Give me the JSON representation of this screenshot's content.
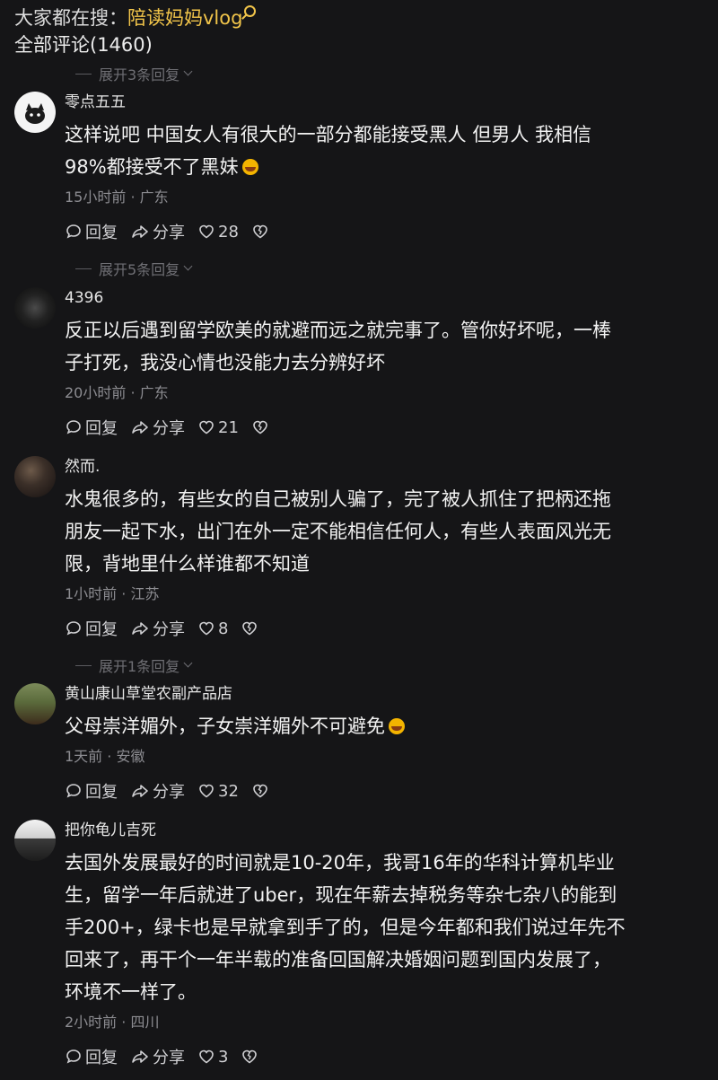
{
  "header": {
    "search_prefix": "大家都在搜：",
    "search_keyword": "陪读妈妈vlog",
    "total_comments": "全部评论(1460)"
  },
  "expand_labels": [
    "展开3条回复",
    "展开5条回复",
    "展开1条回复"
  ],
  "actions": {
    "reply": "回复",
    "share": "分享"
  },
  "comments": [
    {
      "name": "零点五五",
      "text_1": "这样说吧  中国女人有很大的一部分都能接受黑人     但男人  我相信",
      "text_2": "98%都接受不了黑妹",
      "meta": "15小时前 · 广东",
      "likes": "28"
    },
    {
      "name": "4396",
      "text_1": "反正以后遇到留学欧美的就避而远之就完事了。管你好坏呢，一棒",
      "text_2": "子打死，我没心情也没能力去分辨好坏",
      "meta": "20小时前 · 广东",
      "likes": "21"
    },
    {
      "name": "然而.",
      "text_1": "水鬼很多的，有些女的自己被别人骗了，完了被人抓住了把柄还拖",
      "text_2": "朋友一起下水，出门在外一定不能相信任何人，有些人表面风光无",
      "text_3": "限，背地里什么样谁都不知道",
      "meta": "1小时前 · 江苏",
      "likes": "8"
    },
    {
      "name": "黄山康山草堂农副产品店",
      "text_1": "父母崇洋媚外，子女崇洋媚外不可避免",
      "meta": "1天前 · 安徽",
      "likes": "32"
    },
    {
      "name": "把你龟儿吉死",
      "text_1": "去国外发展最好的时间就是10-20年，我哥16年的华科计算机毕业",
      "text_2": "生，留学一年后就进了uber，现在年薪去掉税务等杂七杂八的能到",
      "text_3": "手200+，绿卡也是早就拿到手了的，但是今年都和我们说过年先不",
      "text_4": "回来了，再干个一年半载的准备回国解决婚姻问题到国内发展了，",
      "text_5": "环境不一样了。",
      "meta": "2小时前 · 四川",
      "likes": "3"
    }
  ]
}
